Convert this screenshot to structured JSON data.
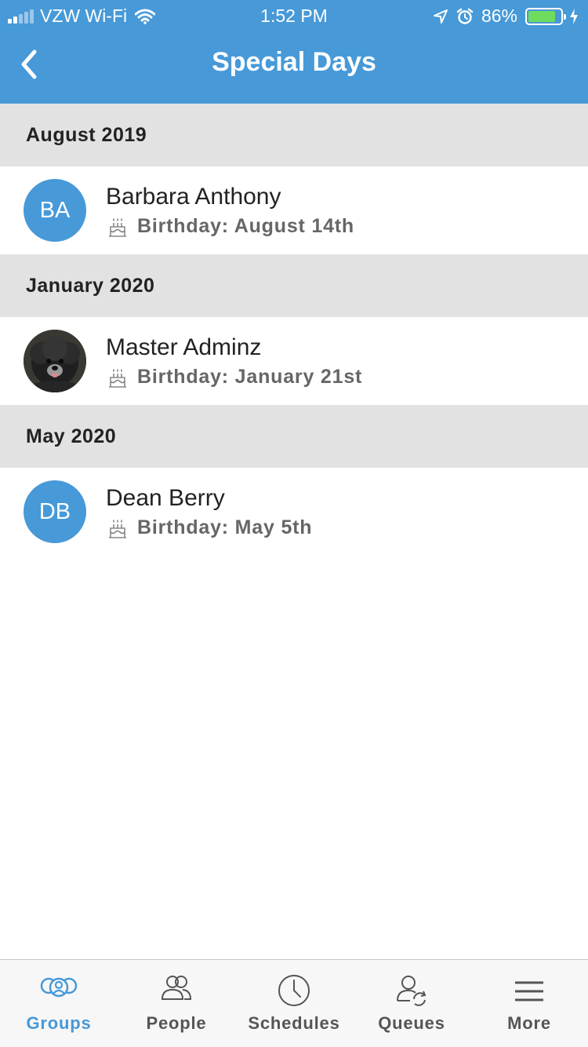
{
  "status_bar": {
    "carrier": "VZW Wi-Fi",
    "time": "1:52 PM",
    "battery_percent": "86%",
    "battery_level": 0.86
  },
  "nav": {
    "title": "Special Days",
    "back_icon": "chevron-left-icon"
  },
  "sections": [
    {
      "header": "August 2019",
      "people": [
        {
          "name": "Barbara Anthony",
          "initials": "BA",
          "detail": "Birthday: August 14th"
        }
      ]
    },
    {
      "header": "January 2020",
      "people": [
        {
          "name": "Master Adminz",
          "initials": "",
          "detail": "Birthday: January 21st",
          "avatar": "dog-photo"
        }
      ]
    },
    {
      "header": "May 2020",
      "people": [
        {
          "name": "Dean Berry",
          "initials": "DB",
          "detail": "Birthday: May 5th"
        }
      ]
    }
  ],
  "tabs": [
    {
      "label": "Groups",
      "icon": "groups-icon",
      "active": true
    },
    {
      "label": "People",
      "icon": "people-icon",
      "active": false
    },
    {
      "label": "Schedules",
      "icon": "clock-icon",
      "active": false
    },
    {
      "label": "Queues",
      "icon": "queue-icon",
      "active": false
    },
    {
      "label": "More",
      "icon": "menu-icon",
      "active": false
    }
  ],
  "colors": {
    "brand": "#4799d8",
    "section_bg": "#e2e2e2",
    "battery": "#6fdc5f"
  }
}
